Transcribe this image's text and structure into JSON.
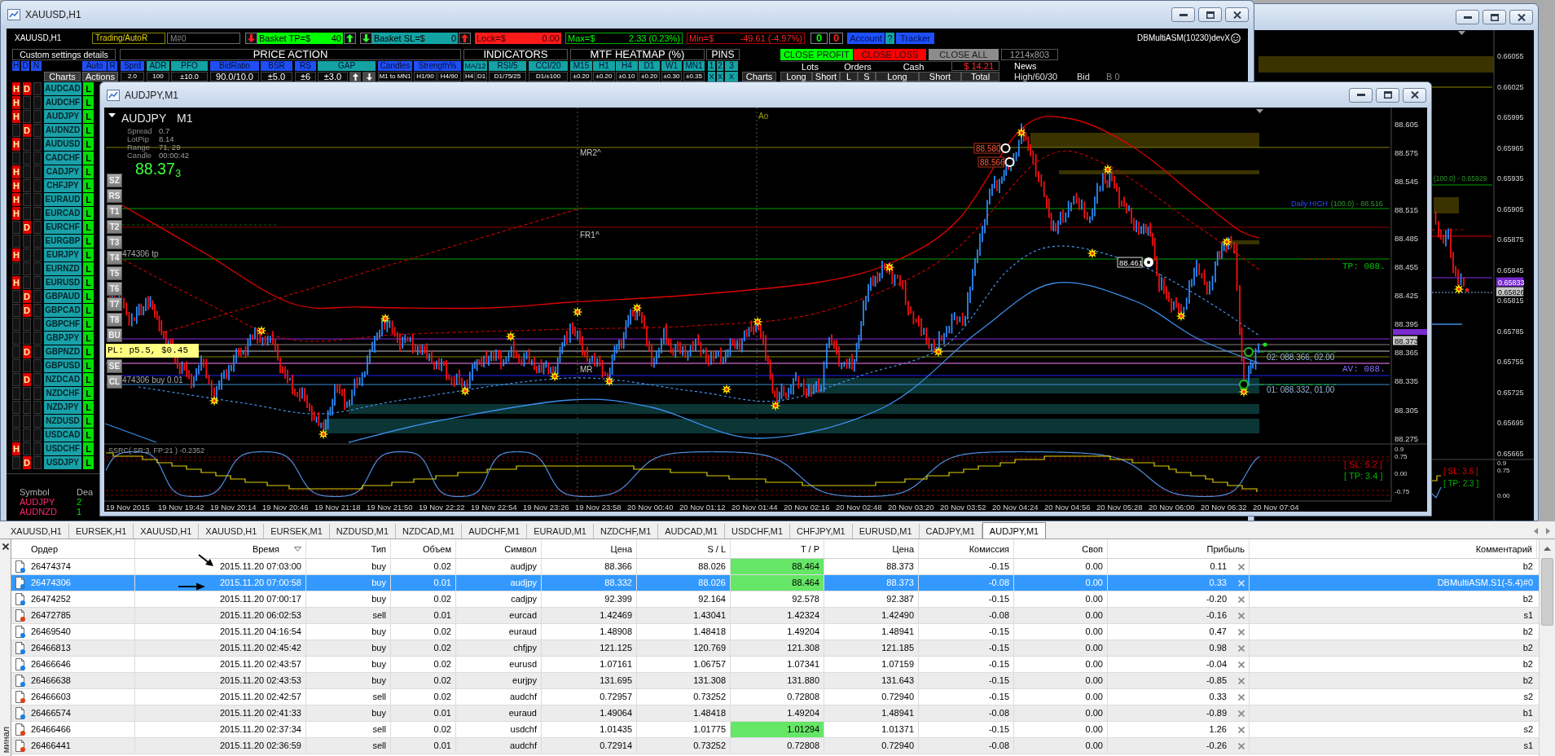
{
  "xauusd_window": {
    "title": "XAUUSD,H1",
    "toolbar": {
      "symbol": "XAUUSD,H1",
      "mode": "Trading/AutoR",
      "magic_placeholder": "M#0",
      "basket_tp": {
        "label": "Basket TP=$",
        "value": "40"
      },
      "basket_sl": {
        "label": "Basket SL=$",
        "value": "0"
      },
      "lock": {
        "label": "Lock=$",
        "value": "0.00"
      },
      "max": {
        "label": "Max=$",
        "value": "2.33 (0.23%)"
      },
      "min": {
        "label": "Min=$",
        "value": "-49.61 (-4.97%)"
      },
      "counters": [
        {
          "text": "0",
          "color": "#00ff00"
        },
        {
          "text": "0",
          "color": "#ff2020"
        }
      ],
      "account": "Account",
      "help": "?",
      "tracker": "Tracker",
      "ea_name": "DBMultiASM(10230)devX"
    },
    "sections": [
      "Custom settings details",
      "PRICE ACTION",
      "INDICATORS",
      "MTF HEATMAP (%)",
      "PINS"
    ],
    "close_buttons": [
      {
        "label": "CLOSE PROFIT",
        "color": "#00ff00"
      },
      {
        "label": "CLOSE LOSS",
        "color": "#ff0000"
      },
      {
        "label": "CLOSE ALL",
        "color": "#8c8c8c"
      }
    ],
    "size_label": "1214x803",
    "filters": [
      {
        "label": "H",
        "color": "#1f4ef5"
      },
      {
        "label": "D",
        "color": "#1f4ef5"
      },
      {
        "label": "N",
        "color": "#1f4ef5"
      },
      {
        "label": "Auto",
        "color": "#1f4ef5"
      },
      {
        "label": "R",
        "color": "#1f4ef5"
      },
      {
        "label": "Sprd",
        "color": "#1f4ef5"
      },
      {
        "label": "ADR",
        "color": "#13a3a3"
      },
      {
        "label": "PFO",
        "color": "#13a3a3"
      },
      {
        "label": "BidRatio",
        "color": "#1f4ef5"
      },
      {
        "label": "BSR",
        "color": "#1f4ef5"
      },
      {
        "label": "RS",
        "color": "#1f4ef5"
      },
      {
        "label": "GAP",
        "color": "#13a3a3"
      },
      {
        "label": "Candles",
        "color": "#1f4ef5"
      },
      {
        "label": "Strength%",
        "color": "#1f4ef5"
      },
      {
        "label": "MA/12",
        "color": "#13a3a3"
      },
      {
        "label": "RSI/5",
        "color": "#13a3a3"
      },
      {
        "label": "CCI/20",
        "color": "#13a3a3"
      },
      {
        "label": "M15",
        "color": "#13a3a3"
      },
      {
        "label": "H1",
        "color": "#13a3a3"
      },
      {
        "label": "H4",
        "color": "#13a3a3"
      },
      {
        "label": "D1",
        "color": "#13a3a3"
      },
      {
        "label": "W1",
        "color": "#13a3a3"
      },
      {
        "label": "MN1",
        "color": "#13a3a3"
      },
      {
        "label": "1",
        "color": "#13a3a3"
      },
      {
        "label": "2",
        "color": "#13a3a3"
      },
      {
        "label": "3",
        "color": "#13a3a3"
      }
    ],
    "summary_headers": [
      "Lots",
      "Orders",
      "Cash"
    ],
    "cash": "$ 14.21",
    "news": "News",
    "settings": [
      {
        "kind": "tab",
        "text": "Charts"
      },
      {
        "kind": "tab",
        "text": "Actions"
      },
      {
        "kind": "value",
        "text": "2.0"
      },
      {
        "kind": "value",
        "text": "100"
      },
      {
        "kind": "value",
        "text": "±10.0"
      },
      {
        "kind": "value",
        "text": "90.0/10.0"
      },
      {
        "kind": "value",
        "text": "±5.0"
      },
      {
        "kind": "value",
        "text": "±6"
      },
      {
        "kind": "value",
        "text": "±3.0"
      },
      {
        "kind": "up"
      },
      {
        "kind": "down"
      },
      {
        "kind": "value",
        "text": "M1 to MN1"
      },
      {
        "kind": "value",
        "text": "H1/90"
      },
      {
        "kind": "value",
        "text": "H4/90"
      },
      {
        "kind": "value",
        "text": "H4"
      },
      {
        "kind": "value",
        "text": "D1"
      },
      {
        "kind": "value",
        "text": "D1/75/25"
      },
      {
        "kind": "value",
        "text": "D1/±100"
      },
      {
        "kind": "value",
        "text": "±0.20"
      },
      {
        "kind": "value",
        "text": "±0.20"
      },
      {
        "kind": "value",
        "text": "±0.10"
      },
      {
        "kind": "value",
        "text": "±0.20"
      },
      {
        "kind": "value",
        "text": "±0.30"
      },
      {
        "kind": "value",
        "text": "±0.35"
      },
      {
        "kind": "pin",
        "text": "X"
      },
      {
        "kind": "pin",
        "text": "X"
      },
      {
        "kind": "pin",
        "text": "X"
      }
    ],
    "summary_columns": [
      "Charts",
      "Long",
      "Short",
      "L",
      "S",
      "Long",
      "Short",
      "Total"
    ],
    "news_row": [
      "High/60/30",
      "Bid",
      "B 0"
    ],
    "symbols": [
      {
        "name": "AUDCAD",
        "h": "H",
        "d": "D",
        "status": "L"
      },
      {
        "name": "AUDCHF",
        "h": "H",
        "status": "L"
      },
      {
        "name": "AUDJPY",
        "h": "H",
        "status": "L"
      },
      {
        "name": "AUDNZD",
        "d": "D",
        "status": "L"
      },
      {
        "name": "AUDUSD",
        "h": "H",
        "status": "L"
      },
      {
        "name": "CADCHF",
        "status": "L"
      },
      {
        "name": "CADJPY",
        "h": "H",
        "status": "L"
      },
      {
        "name": "CHFJPY",
        "h": "H",
        "status": "L"
      },
      {
        "name": "EURAUD",
        "h": "H",
        "status": "L"
      },
      {
        "name": "EURCAD",
        "h": "H",
        "status": "L"
      },
      {
        "name": "EURCHF",
        "d": "D",
        "status": "L"
      },
      {
        "name": "EURGBP",
        "status": "L"
      },
      {
        "name": "EURJPY",
        "h": "H",
        "status": "L"
      },
      {
        "name": "EURNZD",
        "status": "L"
      },
      {
        "name": "EURUSD",
        "h": "H",
        "status": "L"
      },
      {
        "name": "GBPAUD",
        "d": "D",
        "status": "L"
      },
      {
        "name": "GBPCAD",
        "d": "D",
        "status": "L"
      },
      {
        "name": "GBPCHF",
        "status": "L"
      },
      {
        "name": "GBPJPY",
        "status": "L"
      },
      {
        "name": "GBPNZD",
        "d": "D",
        "status": "L"
      },
      {
        "name": "GBPUSD",
        "status": "L"
      },
      {
        "name": "NZDCAD",
        "d": "D",
        "status": "L"
      },
      {
        "name": "NZDCHF",
        "status": "L"
      },
      {
        "name": "NZDJPY",
        "status": "L"
      },
      {
        "name": "NZDUSD",
        "status": "L"
      },
      {
        "name": "USDCAD",
        "status": "L"
      },
      {
        "name": "USDCHF",
        "h": "H",
        "status": "L"
      },
      {
        "name": "USDJPY",
        "d": "D",
        "status": "L"
      }
    ],
    "deals": {
      "columns": [
        "Symbol",
        "Dea"
      ],
      "rows": [
        {
          "symbol": "AUDJPY",
          "count": "2"
        },
        {
          "symbol": "AUDNZD",
          "count": "1"
        }
      ]
    }
  },
  "audjpy_window": {
    "title": "AUDJPY,M1",
    "chart": {
      "symbol": "AUDJPY",
      "timeframe": "M1",
      "info": [
        {
          "label": "Spread",
          "value": "0.7"
        },
        {
          "label": "LotPip",
          "value": "8.14"
        },
        {
          "label": "Range",
          "value": "71, 29"
        },
        {
          "label": "Candle",
          "value": "00:00:42"
        }
      ],
      "bid": "88.37",
      "bid_digit": "3",
      "side_buttons": [
        "SZ",
        "RS",
        "T1",
        "T2",
        "T3",
        "T4",
        "T5",
        "T6",
        "T7",
        "T8",
        "BU",
        "SE",
        "CL"
      ],
      "pl_label": "PL: p5.5, $0.45",
      "order_labels": [
        "474306 tp",
        "474306 buy 0.01"
      ],
      "level_labels": [
        "MR2^",
        "FR1^",
        "MR"
      ],
      "session_label": "Ao",
      "swing_tags": [
        "88.580",
        "88.566"
      ],
      "cursor_tag": "88.461",
      "daily_high": {
        "label": "Daily HIGH",
        "value": "(100.0) - 88.516"
      },
      "tp_label": "TP: 088.",
      "average_label": "AV: 088.",
      "entry_labels": [
        "02: 088.366, 02.00",
        "01: 088.332, 01.00"
      ],
      "price_tag": "88.373",
      "price_axis": [
        "88.605",
        "88.575",
        "88.545",
        "88.515",
        "88.485",
        "88.455",
        "88.425",
        "88.395",
        "88.365",
        "88.335",
        "88.305",
        "88.275"
      ],
      "time_axis": [
        "19 Nov 2015",
        "19 Nov 19:42",
        "19 Nov 20:14",
        "19 Nov 20:46",
        "19 Nov 21:18",
        "19 Nov 21:50",
        "19 Nov 22:22",
        "19 Nov 22:54",
        "19 Nov 23:26",
        "19 Nov 23:58",
        "20 Nov 00:40",
        "20 Nov 01:12",
        "20 Nov 01:44",
        "20 Nov 02:16",
        "20 Nov 02:48",
        "20 Nov 03:20",
        "20 Nov 03:52",
        "20 Nov 04:24",
        "20 Nov 04:56",
        "20 Nov 05:28",
        "20 Nov 06:00",
        "20 Nov 06:32",
        "20 Nov 07:04"
      ],
      "oscillator": {
        "title": "SSRC( SR:3, FP:21 ) -0.2352",
        "sl": "[ SL: 5.2 ]",
        "tp": "[ TP: 3.4 ]",
        "axis": [
          "0.9",
          "0.75",
          "0.00",
          "-0.75"
        ]
      }
    }
  },
  "background_window": {
    "price_axis": [
      "0.66055",
      "0.66025",
      "0.65995",
      "0.65965",
      "0.65935",
      "0.65905",
      "0.65875",
      "0.65845",
      "0.65815",
      "0.65785",
      "0.65755",
      "0.65725",
      "0.65695",
      "0.65665"
    ],
    "fibo_label": "(100.0) - 0.65929",
    "price_tags": [
      {
        "text": "0.65833",
        "color": "#7a2bd0"
      },
      {
        "text": "0.65826",
        "color": "#c8c8c8"
      }
    ],
    "oscillator": {
      "sl": "[ SL: 3.6 ]",
      "tp": "[ TP: 2.3 ]",
      "axis": [
        "0.9",
        "0.75",
        "0.00"
      ]
    }
  },
  "terminal": {
    "side_label": "минал",
    "tabs": [
      {
        "label": "XAUUSD,H1",
        "selected": false
      },
      {
        "label": "EURSEK,H1",
        "selected": false
      },
      {
        "label": "XAUUSD,H1",
        "selected": false
      },
      {
        "label": "XAUUSD,H1",
        "selected": false
      },
      {
        "label": "EURSEK,M1",
        "selected": false
      },
      {
        "label": "NZDUSD,M1",
        "selected": false
      },
      {
        "label": "NZDCAD,M1",
        "selected": false
      },
      {
        "label": "AUDCHF,M1",
        "selected": false
      },
      {
        "label": "EURAUD,M1",
        "selected": false
      },
      {
        "label": "NZDCHF,M1",
        "selected": false
      },
      {
        "label": "AUDCAD,M1",
        "selected": false
      },
      {
        "label": "USDCHF,M1",
        "selected": false
      },
      {
        "label": "CHFJPY,M1",
        "selected": false
      },
      {
        "label": "EURUSD,M1",
        "selected": false
      },
      {
        "label": "CADJPY,M1",
        "selected": false
      },
      {
        "label": "AUDJPY,M1",
        "selected": true
      }
    ],
    "columns": [
      {
        "label": "Ордер",
        "sorted": false
      },
      {
        "label": "Время",
        "sorted": true
      },
      {
        "label": "Тип",
        "sorted": false
      },
      {
        "label": "Объем",
        "sorted": false
      },
      {
        "label": "Символ",
        "sorted": false
      },
      {
        "label": "Цена",
        "sorted": false
      },
      {
        "label": "S / L",
        "sorted": false
      },
      {
        "label": "T / P",
        "sorted": false
      },
      {
        "label": "Цена",
        "sorted": false
      },
      {
        "label": "Комиссия",
        "sorted": false
      },
      {
        "label": "Своп",
        "sorted": false
      },
      {
        "label": "Прибыль",
        "sorted": false
      },
      {
        "label": "Комментарий",
        "sorted": false
      }
    ],
    "rows": [
      {
        "kind": "buy",
        "order": "26474374",
        "time": "2015.11.20 07:03:00",
        "type": "buy",
        "volume": "0.02",
        "symbol": "audjpy",
        "price": "88.366",
        "sl": "88.026",
        "tp": "88.464",
        "tp_highlighted": true,
        "current": "88.373",
        "commission": "-0.15",
        "swap": "0.00",
        "profit": "0.11",
        "comment": "b2",
        "selected": false
      },
      {
        "kind": "buy",
        "order": "26474306",
        "time": "2015.11.20 07:00:58",
        "type": "buy",
        "volume": "0.01",
        "symbol": "audjpy",
        "price": "88.332",
        "sl": "88.026",
        "tp": "88.464",
        "tp_highlighted": true,
        "current": "88.373",
        "commission": "-0.08",
        "swap": "0.00",
        "profit": "0.33",
        "comment": "DBMultiASM.S1(-5.4)#0",
        "selected": true
      },
      {
        "kind": "buy",
        "order": "26474252",
        "time": "2015.11.20 07:00:17",
        "type": "buy",
        "volume": "0.02",
        "symbol": "cadjpy",
        "price": "92.399",
        "sl": "92.164",
        "tp": "92.578",
        "tp_highlighted": false,
        "current": "92.387",
        "commission": "-0.15",
        "swap": "0.00",
        "profit": "-0.20",
        "comment": "b2",
        "selected": false
      },
      {
        "kind": "sell",
        "order": "26472785",
        "time": "2015.11.20 06:02:53",
        "type": "sell",
        "volume": "0.01",
        "symbol": "eurcad",
        "price": "1.42469",
        "sl": "1.43041",
        "tp": "1.42324",
        "tp_highlighted": false,
        "current": "1.42490",
        "commission": "-0.08",
        "swap": "0.00",
        "profit": "-0.16",
        "comment": "s1",
        "selected": false
      },
      {
        "kind": "buy",
        "order": "26469540",
        "time": "2015.11.20 04:16:54",
        "type": "buy",
        "volume": "0.02",
        "symbol": "euraud",
        "price": "1.48908",
        "sl": "1.48418",
        "tp": "1.49204",
        "tp_highlighted": false,
        "current": "1.48941",
        "commission": "-0.15",
        "swap": "0.00",
        "profit": "0.47",
        "comment": "b2",
        "selected": false
      },
      {
        "kind": "buy",
        "order": "26466813",
        "time": "2015.11.20 02:45:42",
        "type": "buy",
        "volume": "0.02",
        "symbol": "chfjpy",
        "price": "121.125",
        "sl": "120.769",
        "tp": "121.308",
        "tp_highlighted": false,
        "current": "121.185",
        "commission": "-0.15",
        "swap": "0.00",
        "profit": "0.98",
        "comment": "b2",
        "selected": false
      },
      {
        "kind": "buy",
        "order": "26466646",
        "time": "2015.11.20 02:43:57",
        "type": "buy",
        "volume": "0.02",
        "symbol": "eurusd",
        "price": "1.07161",
        "sl": "1.06757",
        "tp": "1.07341",
        "tp_highlighted": false,
        "current": "1.07159",
        "commission": "-0.15",
        "swap": "0.00",
        "profit": "-0.04",
        "comment": "b2",
        "selected": false
      },
      {
        "kind": "buy",
        "order": "26466638",
        "time": "2015.11.20 02:43:53",
        "type": "buy",
        "volume": "0.02",
        "symbol": "eurjpy",
        "price": "131.695",
        "sl": "131.308",
        "tp": "131.880",
        "tp_highlighted": false,
        "current": "131.643",
        "commission": "-0.15",
        "swap": "0.00",
        "profit": "-0.85",
        "comment": "b2",
        "selected": false
      },
      {
        "kind": "sell",
        "order": "26466603",
        "time": "2015.11.20 02:42:57",
        "type": "sell",
        "volume": "0.02",
        "symbol": "audchf",
        "price": "0.72957",
        "sl": "0.73252",
        "tp": "0.72808",
        "tp_highlighted": false,
        "current": "0.72940",
        "commission": "-0.15",
        "swap": "0.00",
        "profit": "0.33",
        "comment": "s2",
        "selected": false
      },
      {
        "kind": "buy",
        "order": "26466574",
        "time": "2015.11.20 02:41:33",
        "type": "buy",
        "volume": "0.01",
        "symbol": "euraud",
        "price": "1.49064",
        "sl": "1.48418",
        "tp": "1.49204",
        "tp_highlighted": false,
        "current": "1.48941",
        "commission": "-0.08",
        "swap": "0.00",
        "profit": "-0.89",
        "comment": "b1",
        "selected": false
      },
      {
        "kind": "sell",
        "order": "26466466",
        "time": "2015.11.20 02:37:34",
        "type": "sell",
        "volume": "0.02",
        "symbol": "usdchf",
        "price": "1.01435",
        "sl": "1.01775",
        "tp": "1.01294",
        "tp_highlighted": true,
        "current": "1.01371",
        "commission": "-0.15",
        "swap": "0.00",
        "profit": "1.26",
        "comment": "s2",
        "selected": false
      },
      {
        "kind": "sell",
        "order": "26466441",
        "time": "2015.11.20 02:36:59",
        "type": "sell",
        "volume": "0.01",
        "symbol": "audchf",
        "price": "0.72914",
        "sl": "0.73252",
        "tp": "0.72808",
        "tp_highlighted": false,
        "current": "0.72940",
        "commission": "-0.08",
        "swap": "0.00",
        "profit": "-0.26",
        "comment": "s1",
        "selected": false
      }
    ]
  }
}
